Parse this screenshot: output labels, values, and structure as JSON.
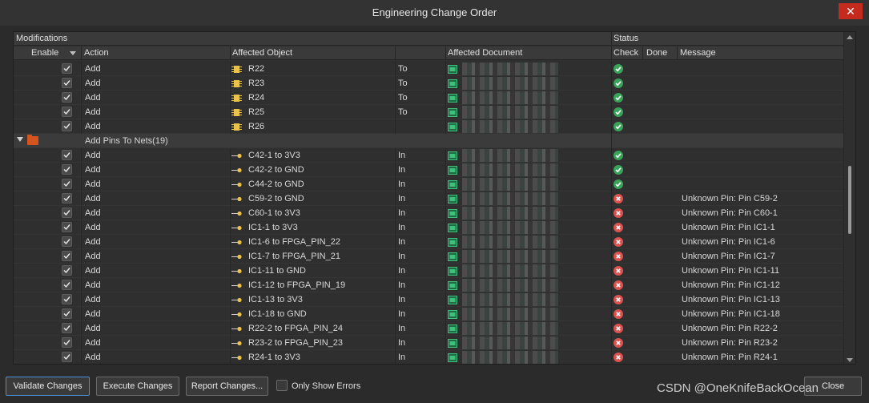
{
  "window": {
    "title": "Engineering Change Order",
    "close_glyph": "✕"
  },
  "grid": {
    "group_headers": {
      "modifications": "Modifications",
      "status": "Status"
    },
    "columns": {
      "enable": "Enable",
      "action": "Action",
      "affected_object": "Affected Object",
      "affected_document": "Affected Document",
      "check": "Check",
      "done": "Done",
      "message": "Message"
    },
    "group_row": {
      "label": "Add Pins To Nets(19)",
      "icon": "folder-icon",
      "expander": "expand-triangle-icon"
    },
    "rows_before": [
      {
        "action": "Add",
        "object": "R22",
        "to": "To",
        "status": "ok",
        "message": ""
      },
      {
        "action": "Add",
        "object": "R23",
        "to": "To",
        "status": "ok",
        "message": ""
      },
      {
        "action": "Add",
        "object": "R24",
        "to": "To",
        "status": "ok",
        "message": ""
      },
      {
        "action": "Add",
        "object": "R25",
        "to": "To",
        "status": "ok",
        "message": ""
      },
      {
        "action": "Add",
        "object": "R26",
        "to": "",
        "status": "ok",
        "message": ""
      }
    ],
    "rows_after": [
      {
        "action": "Add",
        "object": "C42-1 to 3V3",
        "to": "In",
        "status": "ok",
        "message": ""
      },
      {
        "action": "Add",
        "object": "C42-2 to GND",
        "to": "In",
        "status": "ok",
        "message": ""
      },
      {
        "action": "Add",
        "object": "C44-2 to GND",
        "to": "In",
        "status": "ok",
        "message": ""
      },
      {
        "action": "Add",
        "object": "C59-2 to GND",
        "to": "In",
        "status": "err",
        "message": "Unknown Pin: Pin C59-2"
      },
      {
        "action": "Add",
        "object": "C60-1 to 3V3",
        "to": "In",
        "status": "err",
        "message": "Unknown Pin: Pin C60-1"
      },
      {
        "action": "Add",
        "object": "IC1-1 to 3V3",
        "to": "In",
        "status": "err",
        "message": "Unknown Pin: Pin IC1-1"
      },
      {
        "action": "Add",
        "object": "IC1-6 to FPGA_PIN_22",
        "to": "In",
        "status": "err",
        "message": "Unknown Pin: Pin IC1-6"
      },
      {
        "action": "Add",
        "object": "IC1-7 to FPGA_PIN_21",
        "to": "In",
        "status": "err",
        "message": "Unknown Pin: Pin IC1-7"
      },
      {
        "action": "Add",
        "object": "IC1-11 to GND",
        "to": "In",
        "status": "err",
        "message": "Unknown Pin: Pin IC1-11"
      },
      {
        "action": "Add",
        "object": "IC1-12 to FPGA_PIN_19",
        "to": "In",
        "status": "err",
        "message": "Unknown Pin: Pin IC1-12"
      },
      {
        "action": "Add",
        "object": "IC1-13 to 3V3",
        "to": "In",
        "status": "err",
        "message": "Unknown Pin: Pin IC1-13"
      },
      {
        "action": "Add",
        "object": "IC1-18 to GND",
        "to": "In",
        "status": "err",
        "message": "Unknown Pin: Pin IC1-18"
      },
      {
        "action": "Add",
        "object": "R22-2 to FPGA_PIN_24",
        "to": "In",
        "status": "err",
        "message": "Unknown Pin: Pin R22-2"
      },
      {
        "action": "Add",
        "object": "R23-2 to FPGA_PIN_23",
        "to": "In",
        "status": "err",
        "message": "Unknown Pin: Pin R23-2"
      },
      {
        "action": "Add",
        "object": "R24-1 to 3V3",
        "to": "In",
        "status": "err",
        "message": "Unknown Pin: Pin R24-1"
      }
    ]
  },
  "footer": {
    "validate": "Validate Changes",
    "execute": "Execute Changes",
    "report": "Report Changes...",
    "only_show_errors": "Only Show Errors",
    "close": "Close",
    "watermark": "CSDN @OneKnifeBackOcean"
  },
  "colors": {
    "ok": "#3aa35a",
    "err": "#d9534f",
    "close_red": "#c42b1c",
    "folder": "#d4531e"
  }
}
